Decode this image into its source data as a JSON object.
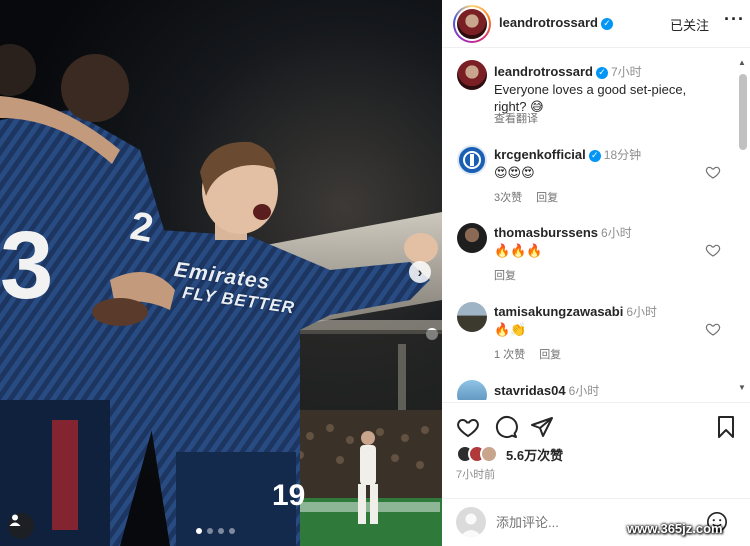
{
  "header": {
    "username": "leandrotrossard",
    "follow_label": "已关注",
    "more_label": "···"
  },
  "media": {
    "jersey_line1": "Emirates",
    "jersey_line2": "FLY BETTER",
    "next_icon": "chevron-right-icon",
    "tag_icon": "user-tag-icon",
    "slide_count": 4,
    "active_slide": 1
  },
  "caption": {
    "username": "leandrotrossard",
    "time": "7小时",
    "text": "Everyone loves a good set-piece, right? 😅",
    "translate": "查看翻译"
  },
  "comments": [
    {
      "username": "krcgenkofficial",
      "verified": true,
      "time": "18分钟",
      "text": "😍😍😍",
      "likes": "3次赞",
      "reply": "回复"
    },
    {
      "username": "thomasburssens",
      "verified": false,
      "time": "6小时",
      "text": "🔥🔥🔥",
      "likes": "",
      "reply": "回复"
    },
    {
      "username": "tamisakungzawasabi",
      "verified": false,
      "time": "6小时",
      "text": "🔥👏",
      "likes": "1 次赞",
      "reply": "回复"
    },
    {
      "username": "stavridas04",
      "verified": false,
      "time": "6小时",
      "text": "",
      "likes": "",
      "reply": ""
    }
  ],
  "actions": {
    "like_icon": "heart-icon",
    "comment_icon": "comment-icon",
    "share_icon": "send-icon",
    "save_icon": "bookmark-icon"
  },
  "likes_summary": "5.6万次赞",
  "post_time": "7小时前",
  "add_comment": {
    "placeholder": "添加评论..."
  },
  "watermark": "www.365jz.com",
  "colors": {
    "verified": "#0095f6",
    "divider": "#efefef",
    "secondary_text": "#8e8e8e"
  }
}
